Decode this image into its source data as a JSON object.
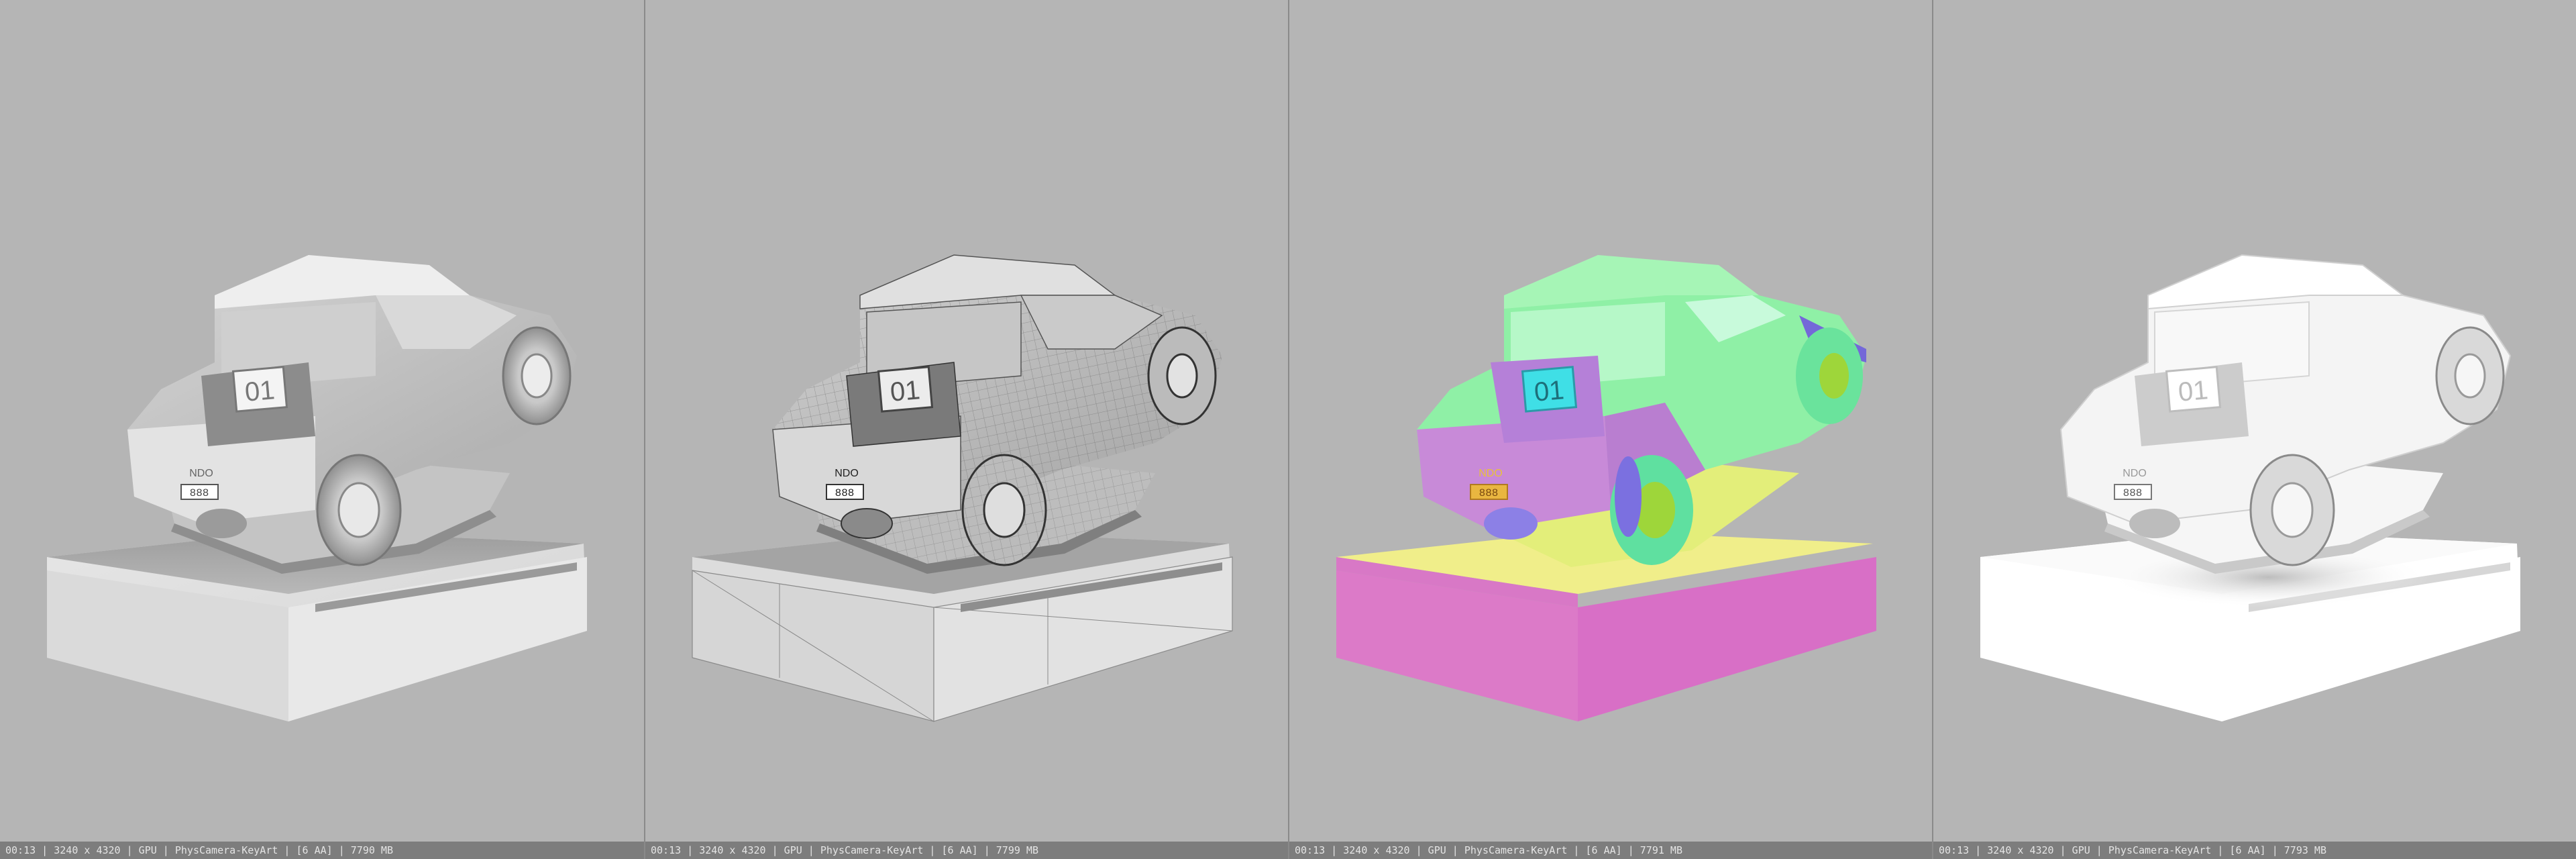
{
  "viewports": [
    {
      "pass": "shaded",
      "badge": "01",
      "plate": "NDO",
      "plate_number": "888",
      "status": "00:13 | 3240 x 4320 | GPU | PhysCamera-KeyArt | [6 AA] | 7790 MB"
    },
    {
      "pass": "wireframe",
      "badge": "01",
      "plate": "NDO",
      "plate_number": "888",
      "status": "00:13 | 3240 x 4320 | GPU | PhysCamera-KeyArt | [6 AA] | 7799 MB"
    },
    {
      "pass": "normals",
      "badge": "01",
      "plate": "NDO",
      "plate_number": "888",
      "status": "00:13 | 3240 x 4320 | GPU | PhysCamera-KeyArt | [6 AA] | 7791 MB"
    },
    {
      "pass": "ambient-occlusion",
      "badge": "01",
      "plate": "NDO",
      "plate_number": "888",
      "status": "00:13 | 3240 x 4320 | GPU | PhysCamera-KeyArt | [6 AA] | 7793 MB"
    }
  ],
  "colors": {
    "viewport_bg": "#b5b5b5",
    "statusbar_bg": "#7d7d7d",
    "statusbar_text": "#e4e4e4",
    "normals_body": "#8ff0a6",
    "normals_rear": "#c88ad8",
    "normals_platform_top": "#e3ee7a",
    "normals_platform_side": "#dc7ac8",
    "normals_badge": "#3fdfe6"
  }
}
